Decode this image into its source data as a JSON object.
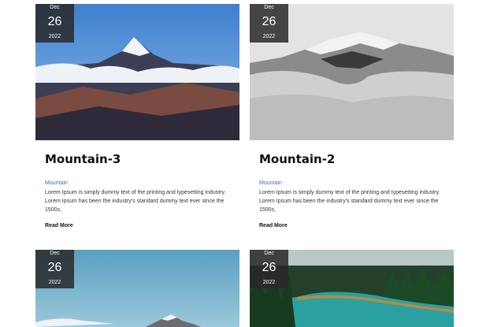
{
  "cards": [
    {
      "date": {
        "month": "Dec",
        "day": "26",
        "year": "2022"
      },
      "title": "Mountain-3",
      "category": "Mountain",
      "excerpt": "Lorem Ipsum is simply dummy text of the printing and typesetting industry. Lorem Ipsum has been the industry's standard dummy text ever since the 1500s,",
      "read_more": "Read More"
    },
    {
      "date": {
        "month": "Dec",
        "day": "26",
        "year": "2022"
      },
      "title": "Mountain-2",
      "category": "Mountain",
      "excerpt": "Lorem Ipsum is simply dummy text of the printing and typesetting industry. Lorem Ipsum has been the industry's standard dummy text ever since the 1500s,",
      "read_more": "Read More"
    },
    {
      "date": {
        "month": "Dec",
        "day": "26",
        "year": "2022"
      }
    },
    {
      "date": {
        "month": "Dec",
        "day": "26",
        "year": "2022"
      }
    }
  ],
  "colors": {
    "category_link": "#3b6fc4",
    "date_badge": "#282828",
    "title": "#111111"
  }
}
